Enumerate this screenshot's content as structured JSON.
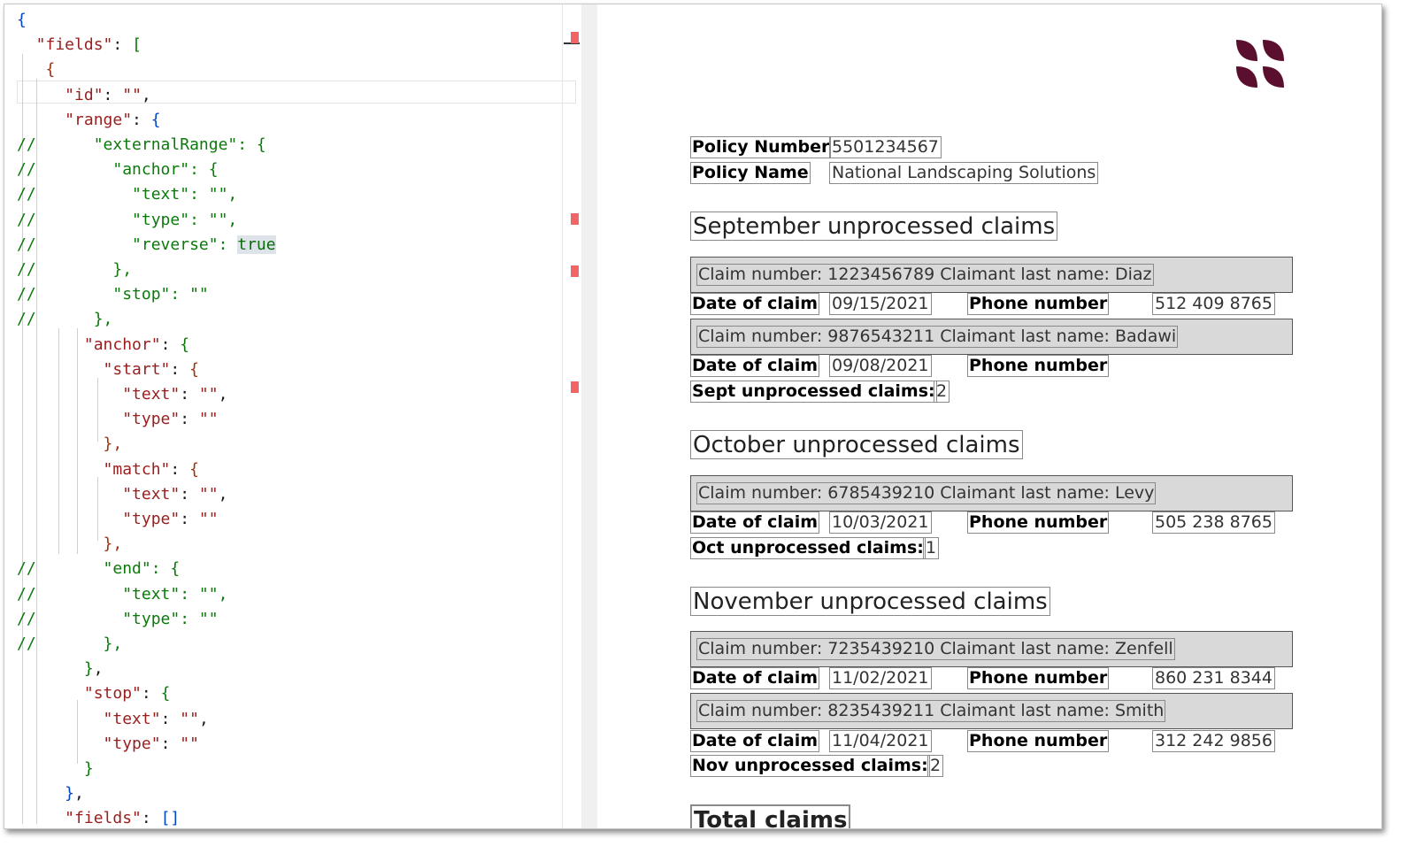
{
  "editor": {
    "lines": [
      {
        "segs": [
          {
            "c": "bb",
            "t": "{"
          }
        ]
      },
      {
        "segs": [
          {
            "c": "k",
            "t": "  \"fields\""
          },
          {
            "c": "p",
            "t": ": "
          },
          {
            "c": "b",
            "t": "["
          }
        ]
      },
      {
        "segs": [
          {
            "c": "br",
            "t": "   {"
          }
        ]
      },
      {
        "segs": [
          {
            "c": "k",
            "t": "     \"id\""
          },
          {
            "c": "p",
            "t": ": "
          },
          {
            "c": "k",
            "t": "\"\""
          },
          {
            "c": "p",
            "t": ","
          }
        ]
      },
      {
        "segs": [
          {
            "c": "k",
            "t": "     \"range\""
          },
          {
            "c": "p",
            "t": ": "
          },
          {
            "c": "bb",
            "t": "{"
          }
        ]
      },
      {
        "segs": [
          {
            "c": "c",
            "t": "//      \"externalRange\": {"
          }
        ]
      },
      {
        "segs": [
          {
            "c": "c",
            "t": "//        \"anchor\": {"
          }
        ]
      },
      {
        "segs": [
          {
            "c": "c",
            "t": "//          \"text\": \"\","
          }
        ]
      },
      {
        "segs": [
          {
            "c": "c",
            "t": "//          \"type\": \"\","
          }
        ]
      },
      {
        "segs": [
          {
            "c": "c",
            "t": "//          \"reverse\": "
          },
          {
            "c": "t",
            "t": "true"
          }
        ]
      },
      {
        "segs": [
          {
            "c": "c",
            "t": "//        },"
          }
        ]
      },
      {
        "segs": [
          {
            "c": "c",
            "t": "//        \"stop\": \"\""
          }
        ]
      },
      {
        "segs": [
          {
            "c": "c",
            "t": "//      },"
          }
        ]
      },
      {
        "segs": [
          {
            "c": "k",
            "t": "       \"anchor\""
          },
          {
            "c": "p",
            "t": ": "
          },
          {
            "c": "b",
            "t": "{"
          }
        ]
      },
      {
        "segs": [
          {
            "c": "k",
            "t": "         \"start\""
          },
          {
            "c": "p",
            "t": ": "
          },
          {
            "c": "br",
            "t": "{"
          }
        ]
      },
      {
        "segs": [
          {
            "c": "k",
            "t": "           \"text\""
          },
          {
            "c": "p",
            "t": ": "
          },
          {
            "c": "k",
            "t": "\"\""
          },
          {
            "c": "p",
            "t": ","
          }
        ]
      },
      {
        "segs": [
          {
            "c": "k",
            "t": "           \"type\""
          },
          {
            "c": "p",
            "t": ": "
          },
          {
            "c": "k",
            "t": "\"\""
          }
        ]
      },
      {
        "segs": [
          {
            "c": "br",
            "t": "         },"
          }
        ]
      },
      {
        "segs": [
          {
            "c": "k",
            "t": "         \"match\""
          },
          {
            "c": "p",
            "t": ": "
          },
          {
            "c": "br",
            "t": "{"
          }
        ]
      },
      {
        "segs": [
          {
            "c": "k",
            "t": "           \"text\""
          },
          {
            "c": "p",
            "t": ": "
          },
          {
            "c": "k",
            "t": "\"\""
          },
          {
            "c": "p",
            "t": ","
          }
        ]
      },
      {
        "segs": [
          {
            "c": "k",
            "t": "           \"type\""
          },
          {
            "c": "p",
            "t": ": "
          },
          {
            "c": "k",
            "t": "\"\""
          }
        ]
      },
      {
        "segs": [
          {
            "c": "br",
            "t": "         },"
          }
        ]
      },
      {
        "segs": [
          {
            "c": "c",
            "t": "//       \"end\": {"
          }
        ]
      },
      {
        "segs": [
          {
            "c": "c",
            "t": "//         \"text\": \"\","
          }
        ]
      },
      {
        "segs": [
          {
            "c": "c",
            "t": "//         \"type\": \"\""
          }
        ]
      },
      {
        "segs": [
          {
            "c": "c",
            "t": "//       },"
          }
        ]
      },
      {
        "segs": [
          {
            "c": "b",
            "t": "       }"
          },
          {
            "c": "p",
            "t": ","
          }
        ]
      },
      {
        "segs": [
          {
            "c": "k",
            "t": "       \"stop\""
          },
          {
            "c": "p",
            "t": ": "
          },
          {
            "c": "b",
            "t": "{"
          }
        ]
      },
      {
        "segs": [
          {
            "c": "k",
            "t": "         \"text\""
          },
          {
            "c": "p",
            "t": ": "
          },
          {
            "c": "k",
            "t": "\"\""
          },
          {
            "c": "p",
            "t": ","
          }
        ]
      },
      {
        "segs": [
          {
            "c": "k",
            "t": "         \"type\""
          },
          {
            "c": "p",
            "t": ": "
          },
          {
            "c": "k",
            "t": "\"\""
          }
        ]
      },
      {
        "segs": [
          {
            "c": "b",
            "t": "       }"
          }
        ]
      },
      {
        "segs": [
          {
            "c": "bb",
            "t": "     }"
          },
          {
            "c": "p",
            "t": ","
          }
        ]
      },
      {
        "segs": [
          {
            "c": "k",
            "t": "     \"fields\""
          },
          {
            "c": "p",
            "t": ": "
          },
          {
            "c": "bb",
            "t": "[]"
          }
        ]
      }
    ]
  },
  "doc": {
    "policy_number_label": "Policy Number",
    "policy_number": "5501234567",
    "policy_name_label": "Policy Name",
    "policy_name": "National Landscaping Solutions",
    "sections": [
      {
        "heading": "September unprocessed claims",
        "claims": [
          {
            "claim": "Claim number: 1223456789     Claimant last name: Diaz",
            "date_label": "Date of claim",
            "date": "09/15/2021",
            "phone_label": "Phone number",
            "phone": "512 409 8765"
          },
          {
            "claim": "Claim number: 9876543211     Claimant last name: Badawi",
            "date_label": "Date of claim",
            "date": "09/08/2021",
            "phone_label": "Phone number",
            "phone": ""
          }
        ],
        "count_label": "Sept unprocessed claims:",
        "count": "2"
      },
      {
        "heading": "October unprocessed claims",
        "claims": [
          {
            "claim": "Claim number: 6785439210     Claimant last name: Levy",
            "date_label": "Date of claim",
            "date": "10/03/2021",
            "phone_label": "Phone number",
            "phone": "505 238 8765"
          }
        ],
        "count_label": "Oct unprocessed claims:",
        "count": "1"
      },
      {
        "heading": "November unprocessed claims",
        "claims": [
          {
            "claim": "Claim number: 7235439210     Claimant last name: Zenfell",
            "date_label": "Date of claim",
            "date": "11/02/2021",
            "phone_label": "Phone number",
            "phone": "860 231 8344"
          },
          {
            "claim": "Claim number: 8235439211     Claimant last name: Smith",
            "date_label": "Date of claim",
            "date": "11/04/2021",
            "phone_label": "Phone number",
            "phone": "312 242 9856"
          }
        ],
        "count_label": "Nov unprocessed claims:",
        "count": "2"
      }
    ],
    "total_label": "Total claims"
  },
  "colors": {
    "logo": "#5a0f2e",
    "bar": "#d9d9d9"
  },
  "icons": {
    "logo": "brand-logo-icon"
  }
}
